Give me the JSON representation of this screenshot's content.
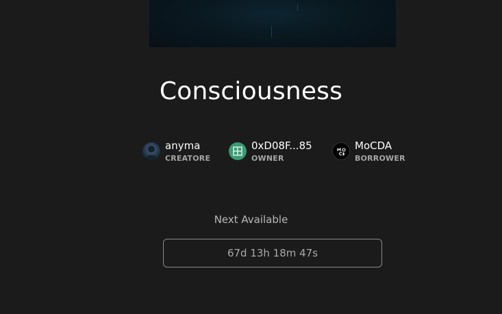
{
  "artwork": {
    "name": "Consciousness"
  },
  "people": [
    {
      "name": "anyma",
      "role": "CREATORE",
      "avatar": "creator-avatar"
    },
    {
      "name": "0xD08F...85",
      "role": "OWNER",
      "avatar": "grid-avatar-icon"
    },
    {
      "name": "MoCDA",
      "role": "BORROWER",
      "avatar": "mocda-logo"
    }
  ],
  "availability": {
    "label": "Next Available",
    "countdown": "67d 13h 18m 47s"
  },
  "colors": {
    "background": "#1b1b1b",
    "text": "#ffffff",
    "muted": "#a6a6a6",
    "owner_avatar": "#3a9a74",
    "border": "#8a8a8a"
  }
}
